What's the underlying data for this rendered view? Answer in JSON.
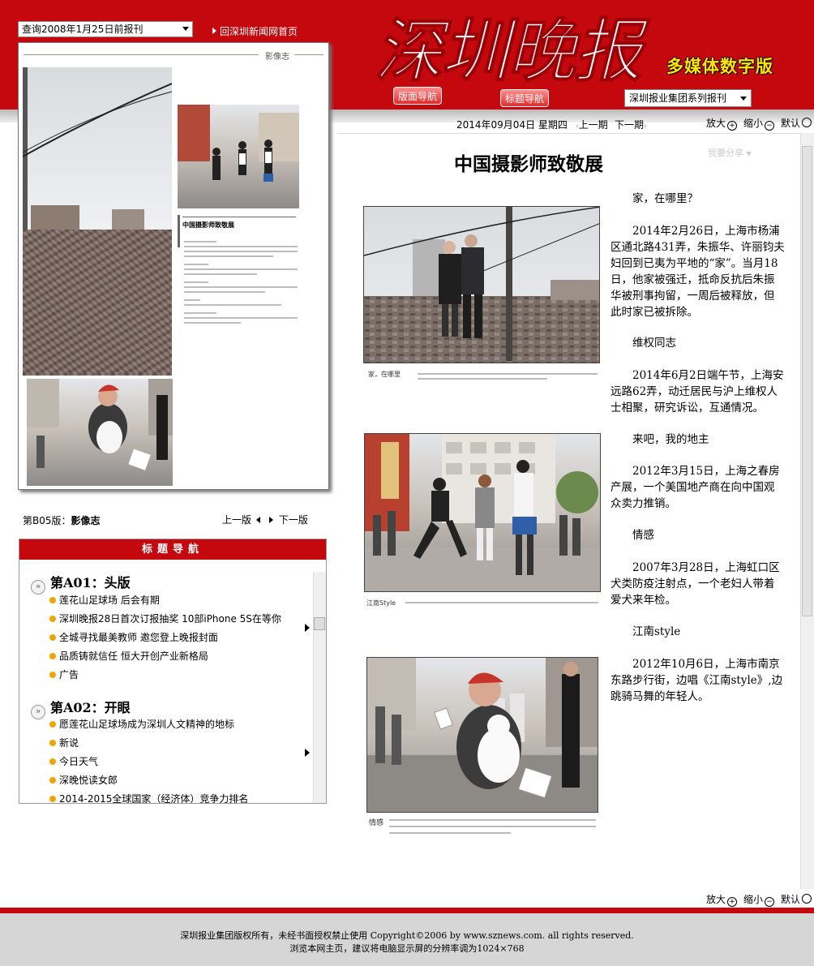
{
  "header": {
    "date_select": "查询2008年1月25日前报刊",
    "home_link": "回深圳新闻网首页",
    "logo_text": "深圳晚报",
    "logo_sub": "多媒体数字版",
    "btn_pages": "版面导航",
    "btn_titles": "标题导航",
    "series_select": "深圳报业集团系列报刊"
  },
  "toolbar": {
    "date": "2014年09月04日 星期四",
    "prev_issue": "上一期",
    "next_issue": "下一期",
    "zoom_in": "放大",
    "zoom_out": "缩小",
    "default": "默认"
  },
  "page_thumbnail": {
    "section_header": "影像志",
    "inner_title": "中国摄影师致敬展"
  },
  "page_info": {
    "label": "第B05版：",
    "name": "影像志",
    "prev": "上一版",
    "next": "下一版"
  },
  "title_nav": {
    "header": "标题导航",
    "sections": [
      {
        "name": "第A01：头版",
        "articles": [
          "莲花山足球场 后会有期",
          "深圳晚报28日首次订报抽奖 10部iPhone 5S在等你",
          "全城寻找最美教师 邀您登上晚报封面",
          "品质铸就信任 恒大开创产业新格局",
          "广告"
        ]
      },
      {
        "name": "第A02：开眼",
        "articles": [
          "愿莲花山足球场成为深圳人文精神的地标",
          "新说",
          "今日天气",
          "深晚悦读女郎",
          "2014-2015全球国家（经济体）竞争力排名"
        ]
      }
    ]
  },
  "article": {
    "title": "中国摄影师致敬展",
    "share": "我要分享",
    "paragraphs": [
      {
        "text": "家，在哪里？",
        "indent": true
      },
      {
        "text": "2014年2月26日，上海市杨浦区通北路431弄，朱振华、许丽钧夫妇回到已夷为平地的“家”。当月18日，他家被强迁，抵命反抗后朱振华被刑事拘留，一周后被释放，但此时家已被拆除。",
        "indent": true
      },
      {
        "text": "维权同志",
        "indent": true
      },
      {
        "text": "2014年6月2日端午节，上海安远路62弄，动迁居民与沪上维权人士相聚，研究诉讼，互通情况。",
        "indent": true
      },
      {
        "text": "来吧，我的地主",
        "indent": true
      },
      {
        "text": "2012年3月15日，上海之春房产展，一个美国地产商在向中国观众卖力推销。",
        "indent": true
      },
      {
        "text": "情感",
        "indent": true
      },
      {
        "text": "2007年3月28日，上海虹口区犬类防疫注射点，一个老妇人带着爱犬来年检。",
        "indent": true
      },
      {
        "text": "江南style",
        "indent": true
      },
      {
        "text": "2012年10月6日，上海市南京东路步行街，边唱《江南style》,边跳骑马舞的年轻人。",
        "indent": true
      }
    ],
    "captions": [
      "家，在哪里",
      "江南Style",
      "情感"
    ]
  },
  "footer": {
    "copyright": "深圳报业集团版权所有，未经书面授权禁止使用 Copyright©2006 by www.sznews.com. all rights reserved.",
    "resolution": "浏览本网主页，建议将电脑显示屏的分辨率调为1024×768"
  },
  "colors": {
    "brand_red": "#c4080e",
    "bullet": "#f0a400"
  }
}
